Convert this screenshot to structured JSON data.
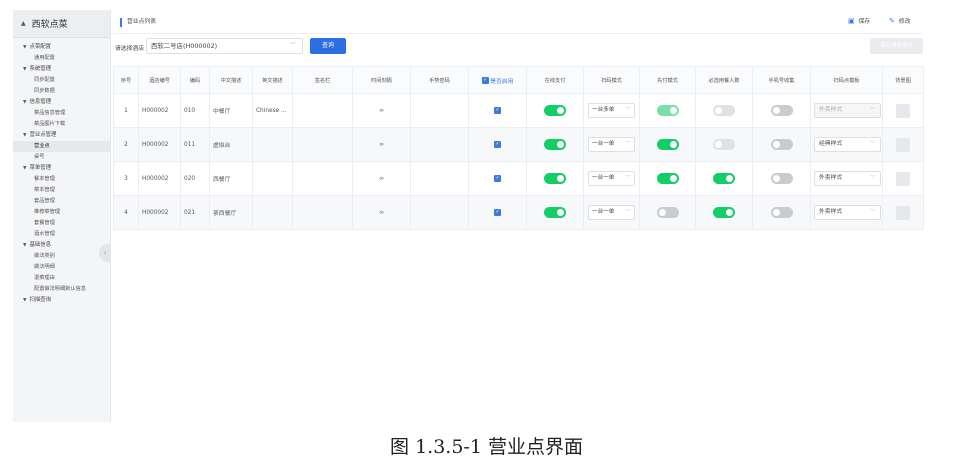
{
  "sidebar": {
    "brand": "西软点菜",
    "menu": [
      {
        "type": "group",
        "label": "点菜配置"
      },
      {
        "type": "item",
        "label": "通用配置"
      },
      {
        "type": "group",
        "label": "系统管理"
      },
      {
        "type": "item",
        "label": "同步配置"
      },
      {
        "type": "item",
        "label": "同步数据"
      },
      {
        "type": "group",
        "label": "信息管理"
      },
      {
        "type": "item",
        "label": "菜品信息管理"
      },
      {
        "type": "item",
        "label": "菜品图片下载"
      },
      {
        "type": "group",
        "label": "营业点管理"
      },
      {
        "type": "item",
        "label": "营业点",
        "active": true
      },
      {
        "type": "item",
        "label": "桌号"
      },
      {
        "type": "group",
        "label": "菜单管理"
      },
      {
        "type": "item",
        "label": "餐本管理"
      },
      {
        "type": "item",
        "label": "菜本管理"
      },
      {
        "type": "item",
        "label": "套品管理"
      },
      {
        "type": "item",
        "label": "推荐菜管理"
      },
      {
        "type": "item",
        "label": "套餐管理"
      },
      {
        "type": "item",
        "label": "酒水管理"
      },
      {
        "type": "group",
        "label": "基础信息"
      },
      {
        "type": "item",
        "label": "做法类别"
      },
      {
        "type": "item",
        "label": "做法明细"
      },
      {
        "type": "item",
        "label": "退菜理由"
      },
      {
        "type": "item",
        "label": "配置做法明细默认信息"
      },
      {
        "type": "group",
        "label": "扫描查询"
      }
    ]
  },
  "page": {
    "title": "营业点列表",
    "save_label": "保存",
    "edit_label": "修改"
  },
  "filter": {
    "label": "请选择酒店",
    "store_value": "西软二号店(H000002)",
    "query_label": "查询",
    "save_order_label": "保存排序顺序"
  },
  "table": {
    "headers": [
      "序号",
      "酒店编号",
      "编码",
      "中文描述",
      "英文描述",
      "签名栏",
      "时间刻隔",
      "手势密码",
      "是否启用",
      "在线支付",
      "扫码模式",
      "先付模式",
      "必选用餐人数",
      "手机号收集",
      "扫码点模板",
      "背景图"
    ],
    "rows": [
      {
        "no": "1",
        "hotel": "H000002",
        "code": "010",
        "cn": "中餐厅",
        "en": "Chinese ...",
        "sign": "",
        "interval": "∞",
        "gesture": "",
        "enabled": true,
        "online_pay": true,
        "scan_mode": "一台多单",
        "prepay": true,
        "prepay_light": true,
        "diners": false,
        "phone": false,
        "template": "外卖样式",
        "template_disabled": true
      },
      {
        "no": "2",
        "hotel": "H000002",
        "code": "011",
        "cn": "虚拟台",
        "en": "",
        "sign": "",
        "interval": "∞",
        "gesture": "",
        "enabled": true,
        "online_pay": true,
        "scan_mode": "一台一单",
        "prepay": true,
        "prepay_light": false,
        "diners": false,
        "phone": false,
        "template": "经典样式",
        "template_disabled": false
      },
      {
        "no": "3",
        "hotel": "H000002",
        "code": "020",
        "cn": "西餐厅",
        "en": "",
        "sign": "",
        "interval": "∞",
        "gesture": "",
        "enabled": true,
        "online_pay": true,
        "scan_mode": "一台一单",
        "prepay": true,
        "prepay_light": false,
        "diners": true,
        "phone": false,
        "template": "外卖样式",
        "template_disabled": false
      },
      {
        "no": "4",
        "hotel": "H000002",
        "code": "021",
        "cn": "茶西餐厅",
        "en": "",
        "sign": "",
        "interval": "∞",
        "gesture": "",
        "enabled": true,
        "online_pay": true,
        "scan_mode": "一台一单",
        "prepay": false,
        "prepay_light": false,
        "diners": true,
        "phone": false,
        "template": "外卖样式",
        "template_disabled": false
      }
    ]
  },
  "caption": "图 1.3.5-1  营业点界面",
  "colors": {
    "accent": "#2d6ee0",
    "toggle_on": "#13ce66",
    "toggle_off": "#c8cbd0"
  },
  "icons": {
    "brand": "triangle-up-icon",
    "save": "save-icon",
    "edit": "pencil-icon",
    "collapse": "chevron-left-icon"
  }
}
